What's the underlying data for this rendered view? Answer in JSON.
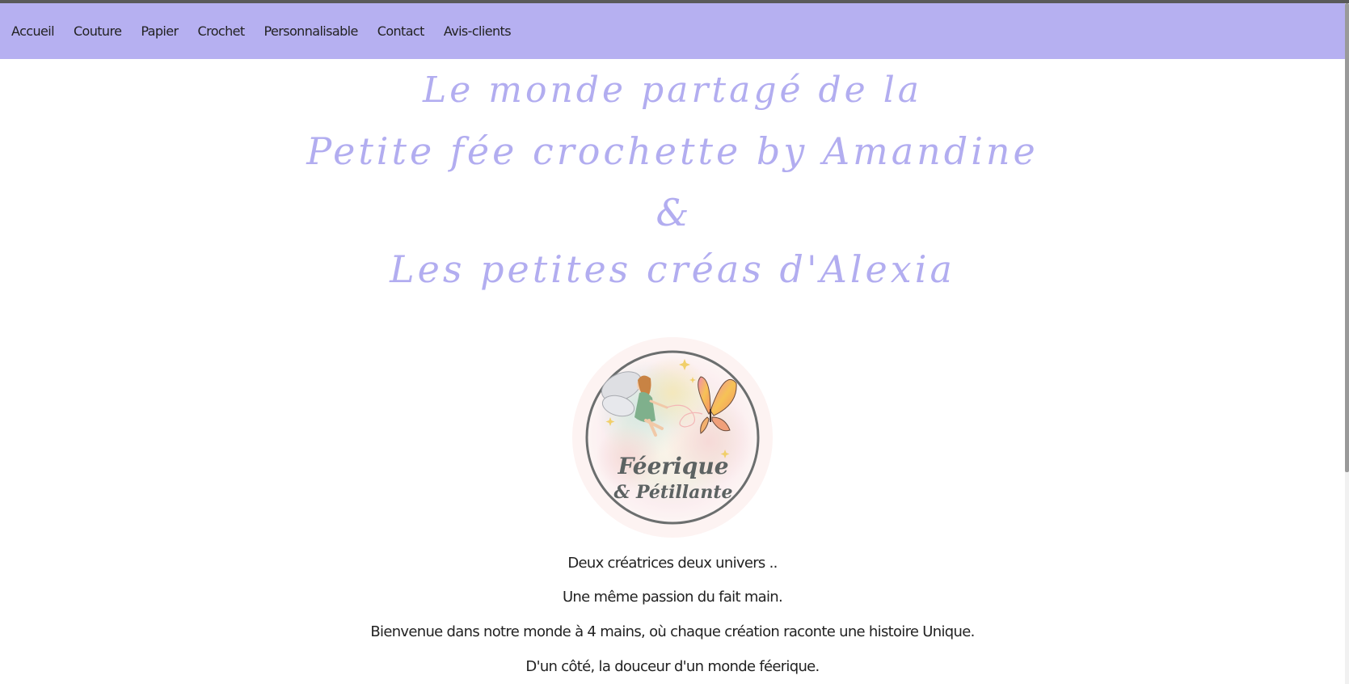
{
  "nav": {
    "items": [
      {
        "label": "Accueil"
      },
      {
        "label": "Couture"
      },
      {
        "label": "Papier"
      },
      {
        "label": "Crochet"
      },
      {
        "label": "Personnalisable"
      },
      {
        "label": "Contact"
      },
      {
        "label": "Avis-clients"
      }
    ]
  },
  "hero": {
    "line1": "Le monde partagé de la",
    "line2": "Petite fée crochette by Amandine",
    "line3": "&",
    "line4": "Les petites créas d'Alexia"
  },
  "logo": {
    "title": "Féerique",
    "subtitle": "& Pétillante",
    "icon": "fairy-butterfly-logo"
  },
  "intro": {
    "line1": "Deux créatrices deux univers ..",
    "line2": "Une même passion du fait main.",
    "line3": "Bienvenue dans notre monde à 4 mains, où chaque création raconte une histoire Unique.",
    "line4": "D'un côté, la douceur d'un monde féerique."
  },
  "colors": {
    "nav_bg": "#b6b0f1",
    "headline": "#b2adf0",
    "logo_ring": "#6b6e6e"
  }
}
